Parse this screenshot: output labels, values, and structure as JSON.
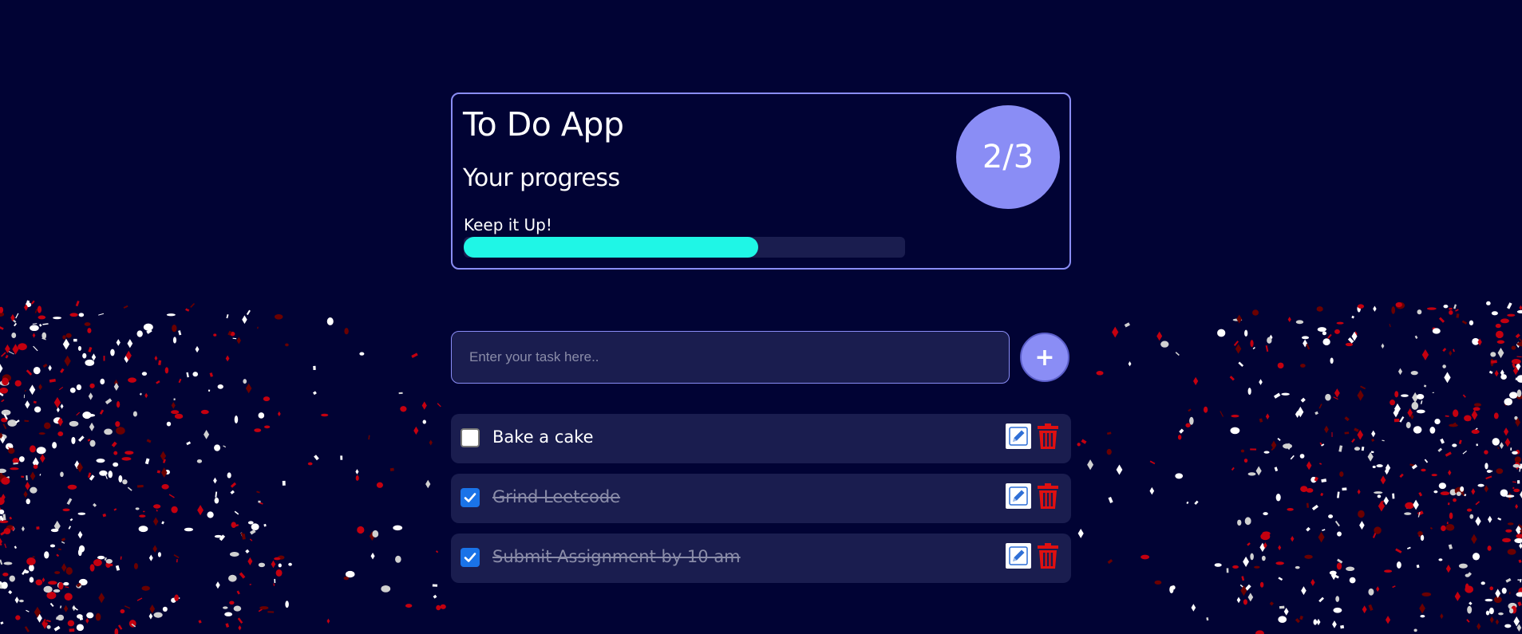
{
  "header": {
    "title": "To Do App",
    "progress_heading": "Your progress",
    "progress_message": "Keep it Up!",
    "progress_fraction": 0.667,
    "progress_badge": "2/3"
  },
  "form": {
    "placeholder": "Enter your task here..",
    "value": "",
    "add_button_label": "+"
  },
  "tasks": [
    {
      "text": "Bake a cake",
      "completed": false
    },
    {
      "text": "Grind Leetcode",
      "completed": true
    },
    {
      "text": "Submit Assignment by 10 am",
      "completed": true
    }
  ],
  "icons": {
    "edit": "pencil-icon",
    "delete": "trash-icon",
    "checkbox_checked": "check-icon"
  },
  "colors": {
    "background": "#010334",
    "accent": "#8a8df5",
    "progress_fill": "#1ff6e6",
    "card": "#1a1d4f",
    "delete": "#e01010",
    "edit": "#2f6fd6",
    "checkbox": "#1a73e8",
    "confetti_red": "#c4000f",
    "confetti_white": "#ffffff"
  }
}
